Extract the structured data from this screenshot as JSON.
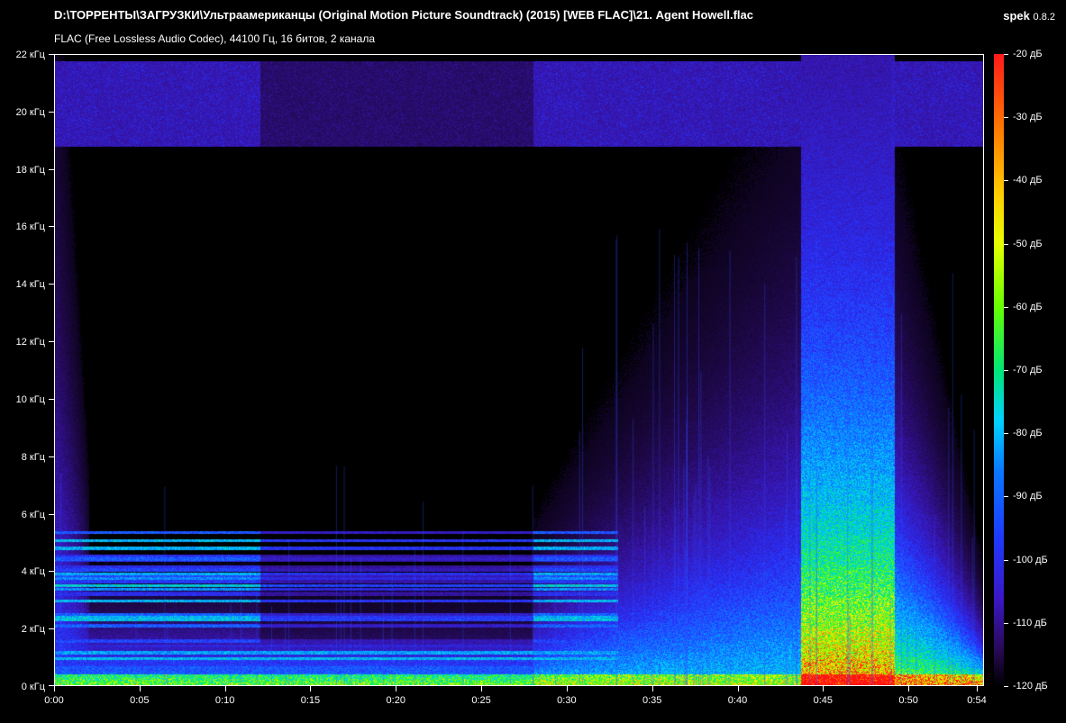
{
  "header": {
    "title": "D:\\ТОРРЕНТЫ\\ЗАГРУЗКИ\\Ультраамериканцы (Original Motion Picture Soundtrack) (2015) [WEB FLAC]\\21. Agent Howell.flac",
    "subtitle": "FLAC (Free Lossless Audio Codec), 44100 Гц, 16 битов, 2 канала",
    "app_name": "spek",
    "app_version": "0.8.2"
  },
  "chart_data": {
    "type": "heatmap",
    "xlabel": "",
    "ylabel": "",
    "x_range_seconds": [
      0,
      54
    ],
    "y_range_khz": [
      0,
      22
    ],
    "color_range_db": [
      -120,
      -20
    ],
    "y_ticks": [
      "0 кГц",
      "2 кГц",
      "4 кГц",
      "6 кГц",
      "8 кГц",
      "10 кГц",
      "12 кГц",
      "14 кГц",
      "16 кГц",
      "18 кГц",
      "20 кГц",
      "22 кГц"
    ],
    "y_tick_values": [
      0,
      2,
      4,
      6,
      8,
      10,
      12,
      14,
      16,
      18,
      20,
      22
    ],
    "x_ticks": [
      "0:00",
      "0:05",
      "0:10",
      "0:15",
      "0:20",
      "0:25",
      "0:30",
      "0:35",
      "0:40",
      "0:45",
      "0:50",
      "0:54"
    ],
    "x_tick_values": [
      0,
      5,
      10,
      15,
      20,
      25,
      30,
      35,
      40,
      45,
      50,
      54
    ],
    "colorbar_ticks": [
      "-20 дБ",
      "-30 дБ",
      "-40 дБ",
      "-50 дБ",
      "-60 дБ",
      "-70 дБ",
      "-80 дБ",
      "-90 дБ",
      "-100 дБ",
      "-110 дБ",
      "-120 дБ"
    ],
    "colorbar_tick_values": [
      -20,
      -30,
      -40,
      -50,
      -60,
      -70,
      -80,
      -90,
      -100,
      -110,
      -120
    ]
  }
}
